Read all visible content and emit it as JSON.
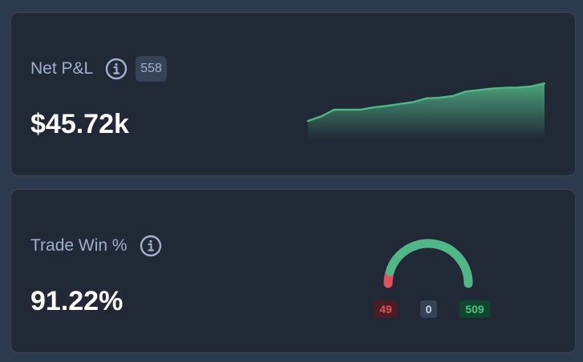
{
  "colors": {
    "page_background": "#2c3a4d",
    "card_background": "#212936",
    "label_text": "#9fb1cc",
    "value_text": "#ffffff",
    "positive_green": "#52b788",
    "negative_red": "#e0525f"
  },
  "net_pnl": {
    "title": "Net P&L",
    "info_icon": "info-circle-icon",
    "trade_count_badge": "558",
    "value": "$45.72k",
    "sparkline_trend": [
      0,
      0.12,
      0.3,
      0.3,
      0.3,
      0.36,
      0.4,
      0.45,
      0.5,
      0.6,
      0.62,
      0.66,
      0.78,
      0.82,
      0.86,
      0.88,
      0.89,
      0.92,
      1.0
    ]
  },
  "trade_win": {
    "title": "Trade Win %",
    "info_icon": "info-circle-icon",
    "value": "91.22%",
    "win_ratio": 0.9122,
    "losses": "49",
    "breakeven": "0",
    "wins": "509"
  }
}
